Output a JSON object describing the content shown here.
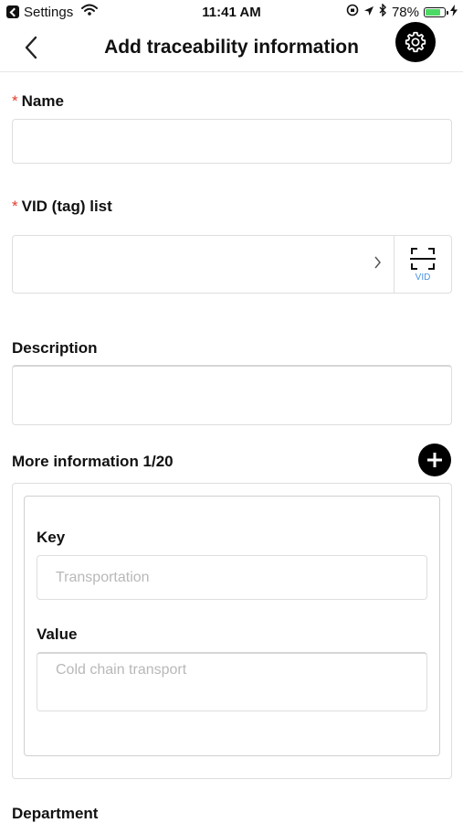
{
  "status_bar": {
    "back_app": "Settings",
    "time": "11:41 AM",
    "battery": "78%",
    "battery_level": 0.78
  },
  "nav": {
    "title": "Add traceability information"
  },
  "form": {
    "name_label": "Name",
    "name_value": "",
    "vid_label": "VID (tag) list",
    "vid_button_label": "VID",
    "description_label": "Description",
    "more_info_label": "More information 1/20",
    "key_label": "Key",
    "key_placeholder": "Transportation",
    "value_label": "Value",
    "value_placeholder": "Cold chain transport",
    "department_label": "Department"
  },
  "icons": {
    "back": "chevron-left-icon",
    "settings": "gear-icon",
    "scan": "scan-icon",
    "add": "plus-icon"
  }
}
